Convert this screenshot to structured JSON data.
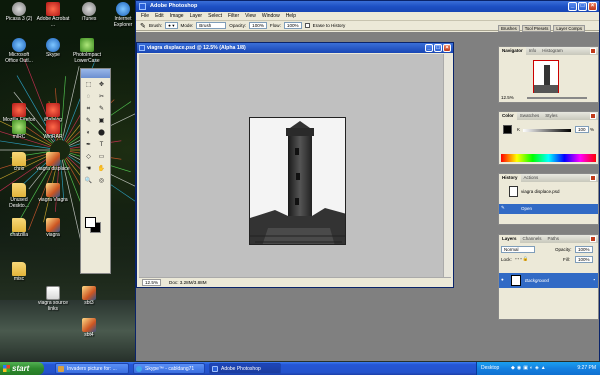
{
  "desktop_icons": [
    {
      "label": "Picasa 3 (2)",
      "icon": "picasa-icon"
    },
    {
      "label": "Adobe Acrobat ...",
      "icon": "acrobat-icon"
    },
    {
      "label": "iTunes",
      "icon": "itunes-icon"
    },
    {
      "label": "Internet Explorer",
      "icon": "ie-icon"
    },
    {
      "label": "Microsoft Office Outl...",
      "icon": "outlook-icon"
    },
    {
      "label": "Skype",
      "icon": "skype-icon"
    },
    {
      "label": "PhotoImpact LowerCase",
      "icon": "photoimpact-icon"
    },
    {
      "label": "Mozilla Firefox",
      "icon": "firefox-icon"
    },
    {
      "label": "iBalalog",
      "icon": "app-icon"
    },
    {
      "label": "mIRC",
      "icon": "mirc-icon"
    },
    {
      "label": "WinRAR",
      "icon": "winrar-icon"
    },
    {
      "label": "chris",
      "icon": "folder-icon"
    },
    {
      "label": "viagra displace",
      "icon": "image-file-icon"
    },
    {
      "label": "Unused Deskto...",
      "icon": "folder-icon"
    },
    {
      "label": "viagra Viagra",
      "icon": "image-file-icon"
    },
    {
      "label": "chatzilla",
      "icon": "folder-icon"
    },
    {
      "label": "viagra",
      "icon": "image-file-icon"
    },
    {
      "label": "misc",
      "icon": "folder-icon"
    },
    {
      "label": "viagra source links",
      "icon": "text-file-icon"
    },
    {
      "label": "sbt3",
      "icon": "image-file-icon"
    },
    {
      "label": "sbt4",
      "icon": "image-file-icon"
    }
  ],
  "photoshop": {
    "title": "Adobe Photoshop",
    "menu": [
      "File",
      "Edit",
      "Image",
      "Layer",
      "Select",
      "Filter",
      "View",
      "Window",
      "Help"
    ],
    "options": {
      "brush_label": "Brush:",
      "mode_label": "Mode:",
      "mode_value": "Brush",
      "opacity_label": "Opacity:",
      "opacity_value": "100%",
      "flow_label": "Flow:",
      "flow_value": "100%",
      "erase_label": "Erase to History"
    },
    "document": {
      "title": "viagra displace.psd @ 12.5% (Alpha 1/8)",
      "zoom": "12.5%",
      "doc_info": "Doc: 3.28M/3.88M"
    },
    "navigator": {
      "tabs": [
        "Navigator",
        "Info",
        "Histogram"
      ],
      "zoom": "12.5%"
    },
    "color": {
      "tabs": [
        "Color",
        "Swatches",
        "Styles"
      ],
      "k_label": "K",
      "k_value": "100",
      "unit": "%"
    },
    "history": {
      "tabs": [
        "History",
        "Actions"
      ],
      "items": [
        "viagra displace.psd",
        "Open"
      ]
    },
    "layers": {
      "tabs": [
        "Layers",
        "Channels",
        "Paths"
      ],
      "blend": "Normal",
      "opacity_label": "Opacity:",
      "opacity_value": "100%",
      "lock_label": "Lock:",
      "fill_label": "Fill:",
      "fill_value": "100%",
      "layer_name": "Background"
    },
    "brushes_label": "Brushes",
    "toolpresets_label": "Tool Presets",
    "layercomps_label": "Layer Comps"
  },
  "taskbar": {
    "start_label": "start",
    "buttons": [
      {
        "label": "Invaders picture for: ...",
        "color": "#d8a040"
      },
      {
        "label": "Skype™ - cabldang71",
        "color": "#40a8e8"
      },
      {
        "label": "Adobe Photoshop",
        "color": "#2a5fd8"
      }
    ],
    "tray_desktop": "Desktop",
    "clock": "9:27 PM"
  },
  "colors": {
    "xp_blue": "#2456d6",
    "start_green": "#2e8a2e",
    "ps_gray": "#808080"
  }
}
